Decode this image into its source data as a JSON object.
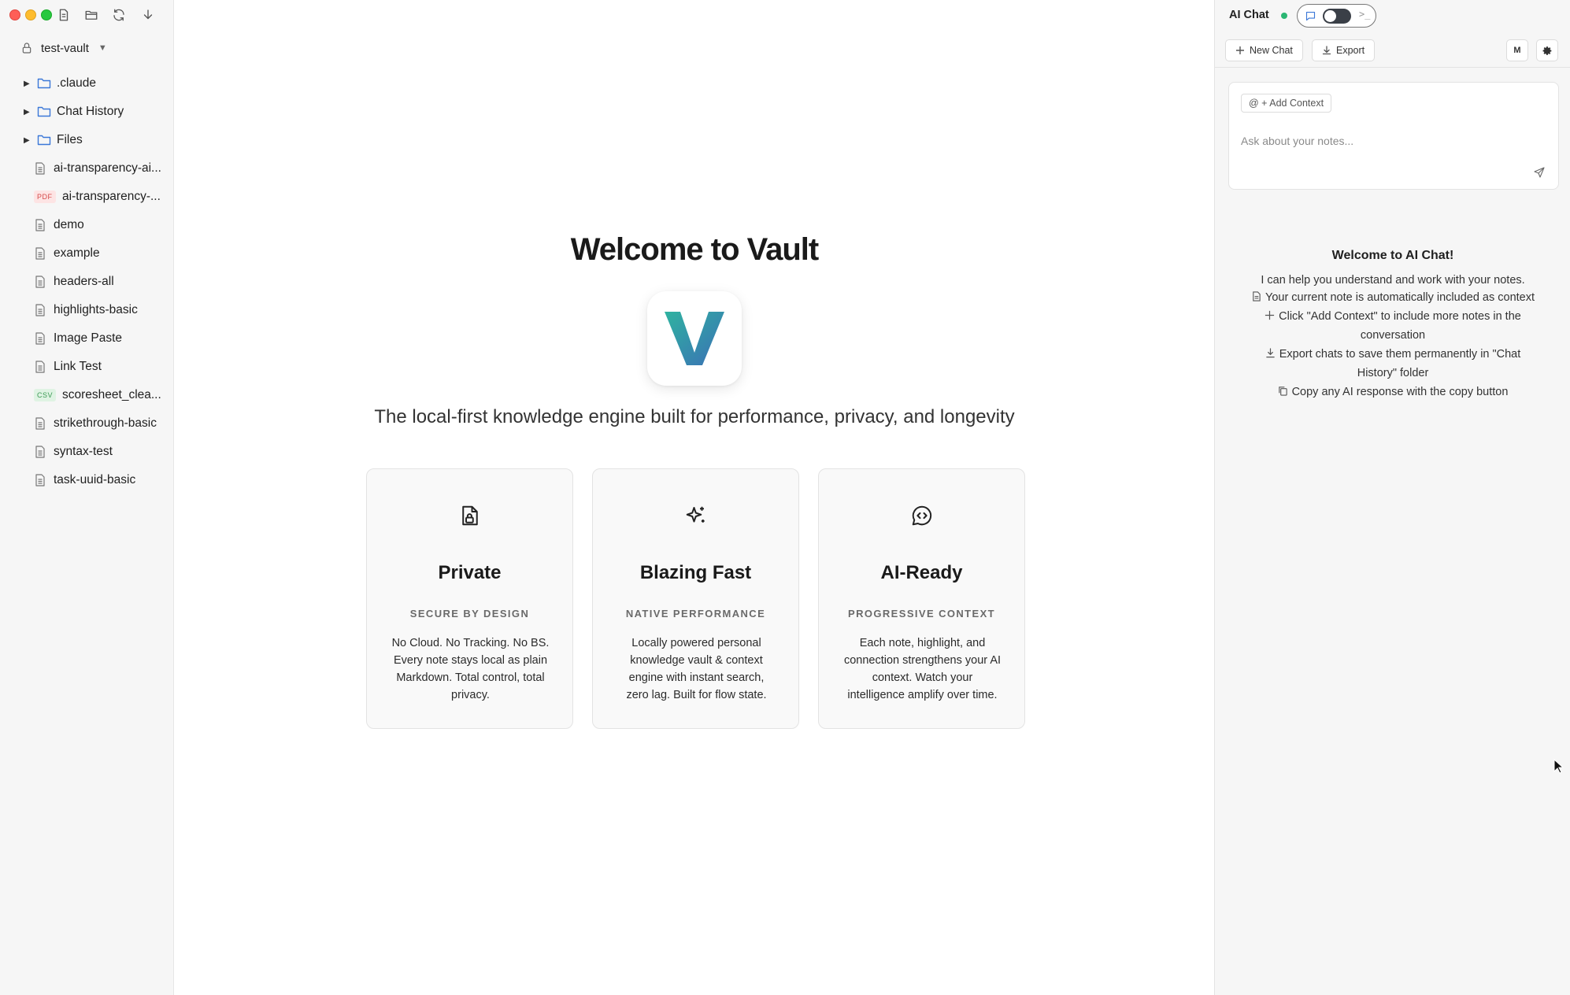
{
  "sidebar": {
    "toolbar_icons": [
      "new-note-icon",
      "open-folder-icon",
      "refresh-icon",
      "download-icon"
    ],
    "vault": {
      "name": "test-vault",
      "caret": "▼"
    },
    "tree": [
      {
        "type": "folder",
        "label": ".claude"
      },
      {
        "type": "folder",
        "label": "Chat History"
      },
      {
        "type": "folder",
        "label": "Files"
      },
      {
        "type": "file",
        "label": "ai-transparency-ai..."
      },
      {
        "type": "pdf",
        "badge": "PDF",
        "label": "ai-transparency-..."
      },
      {
        "type": "file",
        "label": "demo"
      },
      {
        "type": "file",
        "label": "example"
      },
      {
        "type": "file",
        "label": "headers-all"
      },
      {
        "type": "file",
        "label": "highlights-basic"
      },
      {
        "type": "file",
        "label": "Image Paste"
      },
      {
        "type": "file",
        "label": "Link Test"
      },
      {
        "type": "csv",
        "badge": "CSV",
        "label": "scoresheet_clea..."
      },
      {
        "type": "file",
        "label": "strikethrough-basic"
      },
      {
        "type": "file",
        "label": "syntax-test"
      },
      {
        "type": "file",
        "label": "task-uuid-basic"
      }
    ]
  },
  "main": {
    "title": "Welcome to Vault",
    "logo_letter": "V",
    "tagline": "The local-first knowledge engine built for performance, privacy, and longevity",
    "cards": [
      {
        "icon": "file-lock-icon",
        "title": "Private",
        "subtitle": "SECURE BY DESIGN",
        "description": "No Cloud. No Tracking. No BS. Every note stays local as plain Markdown. Total control, total privacy."
      },
      {
        "icon": "sparkles-icon",
        "title": "Blazing Fast",
        "subtitle": "NATIVE PERFORMANCE",
        "description": "Locally powered personal knowledge vault & context engine with instant search, zero lag. Built for flow state."
      },
      {
        "icon": "message-code-icon",
        "title": "AI-Ready",
        "subtitle": "PROGRESSIVE CONTEXT",
        "description": "Each note, highlight, and connection strengthens your AI context. Watch your intelligence amplify over time."
      }
    ]
  },
  "chat": {
    "title": "AI Chat",
    "status_color": "#2bb673",
    "mode_toggle": {
      "terminal_glyph": ">_"
    },
    "toolbar": {
      "new_chat": "New Chat",
      "export": "Export",
      "model_button": "M"
    },
    "input": {
      "add_context": "@ + Add Context",
      "placeholder": "Ask about your notes..."
    },
    "welcome": {
      "title": "Welcome to AI Chat!",
      "intro": "I can help you understand and work with your notes.",
      "tips": [
        {
          "icon": "document-icon",
          "text": "Your current note is automatically included as context"
        },
        {
          "icon": "plus-icon",
          "text": "Click \"Add Context\" to include more notes in the conversation"
        },
        {
          "icon": "download-icon",
          "text": "Export chats to save them permanently in \"Chat History\" folder"
        },
        {
          "icon": "copy-icon",
          "text": "Copy any AI response with the copy button"
        }
      ]
    }
  },
  "colors": {
    "folder_blue": "#3b78d8",
    "accent_green": "#2bb673",
    "logo_gradient": [
      "#2fb3a0",
      "#3b6fb6"
    ]
  }
}
